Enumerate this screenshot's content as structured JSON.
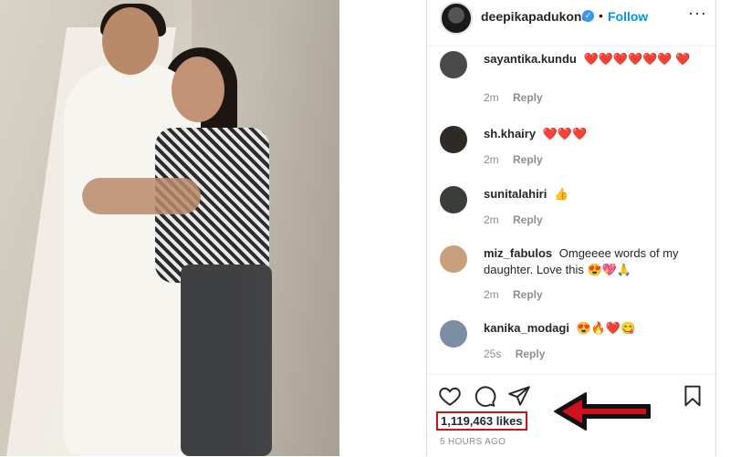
{
  "post": {
    "username": "deepikapadukone",
    "follow_label": "Follow",
    "separator": "•",
    "more_label": "···",
    "verified_mark": "✓"
  },
  "comments": [
    {
      "user": "sayantika.kundu",
      "text": "❤️❤️❤️❤️❤️❤️ ❤️",
      "time": "2m",
      "reply": "Reply",
      "avatar_color": "#4a4a4a"
    },
    {
      "user": "sh.khairy",
      "text": "❤️❤️❤️",
      "time": "2m",
      "reply": "Reply",
      "avatar_color": "#2e2a26"
    },
    {
      "user": "sunitalahiri",
      "text": "👍",
      "time": "2m",
      "reply": "Reply",
      "avatar_color": "#3a3d38"
    },
    {
      "user": "miz_fabulos",
      "text": "Omgeeee words of my daughter. Love this 😍💖🙏",
      "time": "2m",
      "reply": "Reply",
      "avatar_color": "#c9a07c"
    },
    {
      "user": "kanika_modagi",
      "text": "😍🔥❤️😋",
      "time": "25s",
      "reply": "Reply",
      "avatar_color": "#7b8ea3"
    }
  ],
  "actions": {
    "likes": "1,119,463 likes",
    "timestamp": "5 HOURS AGO",
    "icons": [
      "heart-icon",
      "comment-icon",
      "share-icon",
      "bookmark-icon"
    ]
  },
  "colors": {
    "follow": "#0095f6",
    "highlight_red": "#d0101a"
  }
}
